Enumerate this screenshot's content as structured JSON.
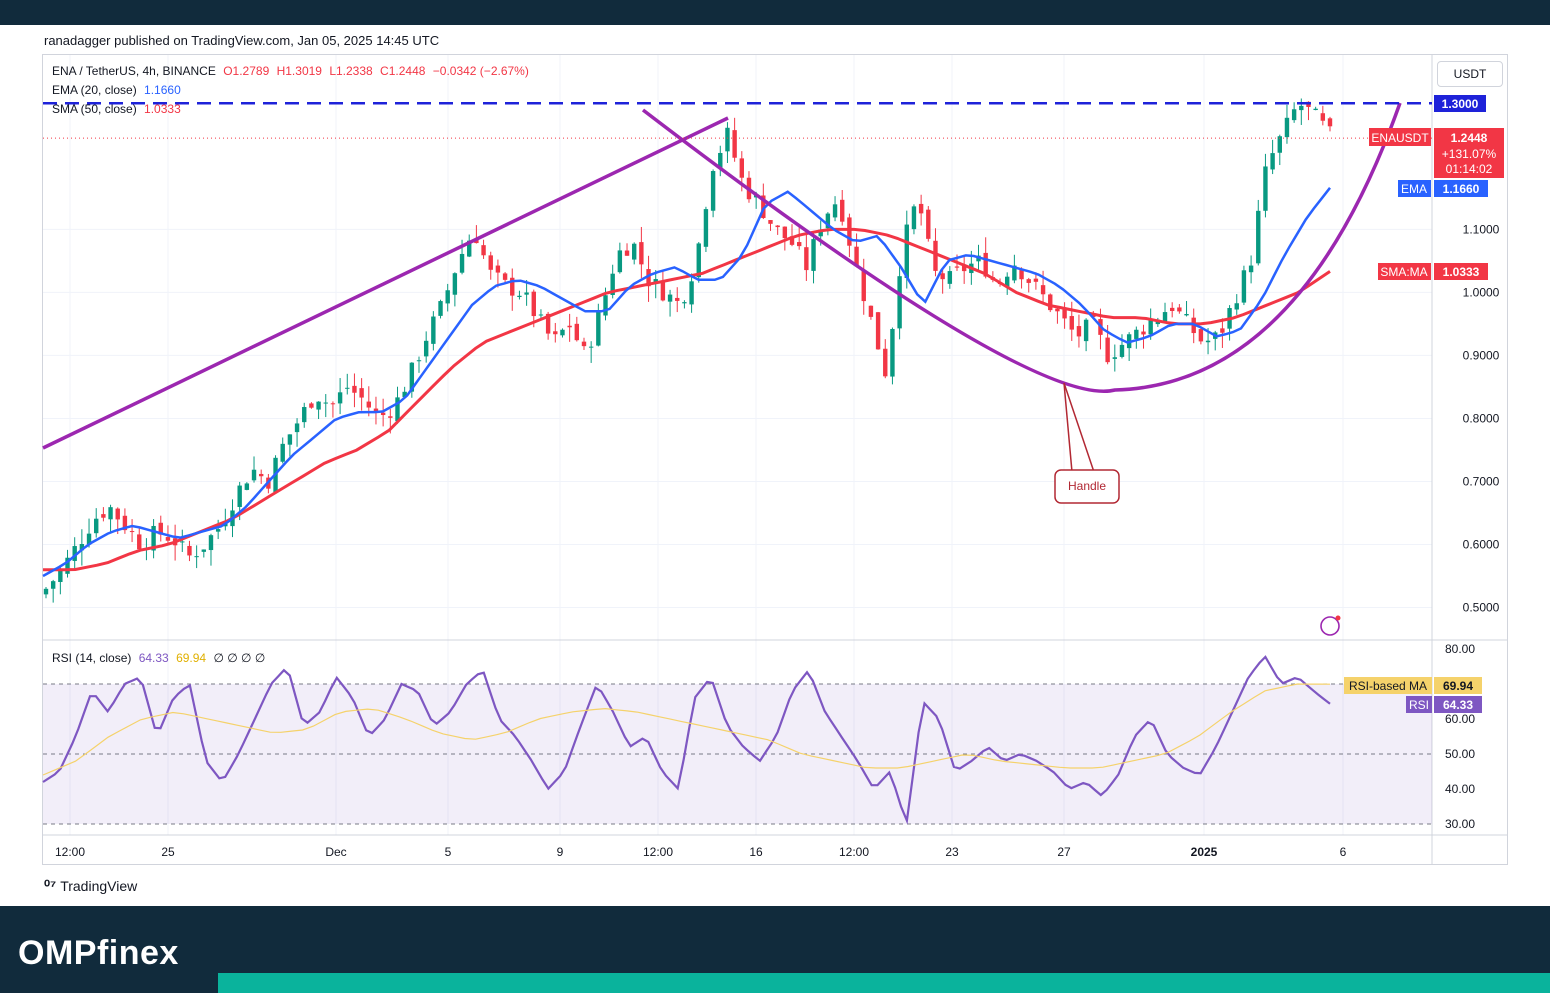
{
  "header": {
    "publisher": "ranadagger published on TradingView.com, Jan 05, 2025 14:45 UTC"
  },
  "legend": {
    "symbol": "ENA / TetherUS, 4h, BINANCE",
    "open": "O1.2789",
    "high": "H1.3019",
    "low": "L1.2338",
    "close": "C1.2448",
    "change": "−0.0342 (−2.67%)",
    "ema_label": "EMA (20, close)",
    "ema_value": "1.1660",
    "sma_label": "SMA (50, close)",
    "sma_value": "1.0333",
    "rsi_label": "RSI (14, close)",
    "rsi_value": "64.33",
    "rsi_ma_value": "69.94",
    "rsi_extras": "∅ ∅ ∅ ∅"
  },
  "price_axis": {
    "currency_button": "USDT",
    "ticks": [
      "1.1000",
      "1.0000",
      "0.9000",
      "0.8000",
      "0.7000",
      "0.6000",
      "0.5000"
    ],
    "resistance_label": "1.3000",
    "last_price": {
      "symbol": "ENAUSDT",
      "price": "1.2448",
      "change": "+131.07%",
      "countdown": "01:14:02"
    },
    "ema_tag": {
      "name": "EMA",
      "value": "1.1660"
    },
    "sma_tag": {
      "name": "SMA:MA",
      "value": "1.0333"
    }
  },
  "rsi_axis": {
    "ticks": [
      "80.00",
      "60.00",
      "50.00",
      "40.00",
      "30.00"
    ],
    "rsi_ma_tag": {
      "name": "RSI-based MA",
      "value": "69.94"
    },
    "rsi_tag": {
      "name": "RSI",
      "value": "64.33"
    }
  },
  "time_axis": {
    "labels": [
      "12:00",
      "25",
      "Dec",
      "5",
      "9",
      "12:00",
      "16",
      "12:00",
      "23",
      "27",
      "2025",
      "6"
    ]
  },
  "annotation": {
    "handle_label": "Handle"
  },
  "footer": {
    "tradingview_logo": "TradingView",
    "brand": "OMPfinex"
  },
  "colors": {
    "up": "#089981",
    "down": "#f23645",
    "ema": "#2962ff",
    "sma": "#f23645",
    "pattern": "#9c27b0",
    "resistance": "#1e22d9",
    "rsi": "#7e57c2",
    "rsi_ma": "#f5d26b",
    "dark_bg": "#112b3c",
    "accent": "#0ab39c"
  },
  "chart_data": {
    "type": "candlestick",
    "title": "ENA / TetherUS, 4h, BINANCE",
    "ylim": [
      0.45,
      1.33
    ],
    "resistance": 1.3,
    "x_labels": [
      "12:00",
      "25",
      "Dec",
      "5",
      "9",
      "12:00",
      "16",
      "12:00",
      "23",
      "27",
      "2025",
      "6"
    ],
    "close_path": [
      0.53,
      0.56,
      0.6,
      0.64,
      0.66,
      0.63,
      0.6,
      0.62,
      0.61,
      0.58,
      0.6,
      0.63,
      0.68,
      0.72,
      0.7,
      0.76,
      0.8,
      0.84,
      0.82,
      0.85,
      0.83,
      0.8,
      0.82,
      0.87,
      0.93,
      0.98,
      1.05,
      1.1,
      1.03,
      1.01,
      1.0,
      0.96,
      0.92,
      0.95,
      0.9,
      0.97,
      1.06,
      1.08,
      1.02,
      1.0,
      0.98,
      1.05,
      1.2,
      1.25,
      1.17,
      1.14,
      1.1,
      1.08,
      1.04,
      1.12,
      1.15,
      1.05,
      0.96,
      0.87,
      1.07,
      1.15,
      1.03,
      1.02,
      1.04,
      1.05,
      1.01,
      1.05,
      1.02,
      0.99,
      0.96,
      0.93,
      0.95,
      0.9,
      0.92,
      0.94,
      0.96,
      0.98,
      0.95,
      0.92,
      0.93,
      0.99,
      1.05,
      1.2,
      1.25,
      1.3,
      1.28,
      1.25
    ],
    "ema20_path": [
      0.55,
      0.57,
      0.6,
      0.62,
      0.63,
      0.62,
      0.61,
      0.62,
      0.63,
      0.66,
      0.7,
      0.74,
      0.77,
      0.8,
      0.81,
      0.81,
      0.83,
      0.88,
      0.93,
      0.98,
      1.01,
      1.02,
      1.01,
      0.99,
      0.97,
      0.97,
      1.01,
      1.03,
      1.04,
      1.02,
      1.02,
      1.06,
      1.14,
      1.16,
      1.13,
      1.1,
      1.08,
      1.09,
      1.04,
      0.98,
      1.05,
      1.06,
      1.05,
      1.04,
      1.03,
      1.01,
      0.98,
      0.94,
      0.92,
      0.93,
      0.95,
      0.95,
      0.93,
      0.94,
      0.99,
      1.06,
      1.12,
      1.166
    ],
    "sma50_path": [
      0.56,
      0.56,
      0.57,
      0.59,
      0.6,
      0.62,
      0.64,
      0.67,
      0.7,
      0.73,
      0.75,
      0.78,
      0.83,
      0.88,
      0.92,
      0.94,
      0.96,
      0.98,
      1.0,
      1.01,
      1.02,
      1.03,
      1.05,
      1.07,
      1.09,
      1.1,
      1.1,
      1.09,
      1.07,
      1.05,
      1.03,
      1.0,
      0.98,
      0.97,
      0.96,
      0.96,
      0.95,
      0.95,
      0.96,
      0.98,
      1.0,
      1.0333
    ],
    "rsi_ylim": [
      30,
      80
    ],
    "rsi_levels": [
      70,
      50,
      30
    ],
    "rsi_path": [
      42,
      45,
      55,
      68,
      62,
      70,
      72,
      55,
      66,
      70,
      48,
      42,
      50,
      60,
      70,
      75,
      58,
      62,
      72,
      66,
      55,
      60,
      70,
      68,
      58,
      62,
      70,
      74,
      60,
      55,
      48,
      40,
      45,
      58,
      70,
      62,
      52,
      55,
      45,
      40,
      66,
      72,
      58,
      52,
      48,
      55,
      68,
      74,
      62,
      55,
      48,
      40,
      45,
      30,
      65,
      60,
      45,
      48,
      52,
      48,
      50,
      48,
      45,
      40,
      42,
      38,
      44,
      55,
      60,
      50,
      46,
      44,
      52,
      62,
      72,
      78,
      70,
      72,
      68,
      64.33
    ],
    "rsi_ma_path": [
      44,
      48,
      55,
      60,
      62,
      60,
      58,
      56,
      57,
      62,
      63,
      60,
      56,
      54,
      56,
      60,
      62,
      63,
      62,
      60,
      58,
      56,
      54,
      50,
      48,
      46,
      46,
      48,
      50,
      48,
      47,
      46,
      46,
      48,
      50,
      55,
      62,
      68,
      70,
      69.94
    ]
  }
}
